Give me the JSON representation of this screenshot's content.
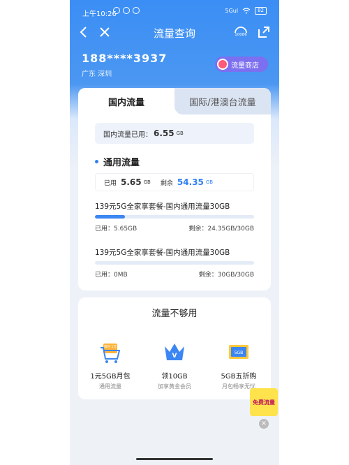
{
  "status_bar": {
    "time": "上午10:26",
    "signal": "5Gul",
    "battery": "82"
  },
  "nav": {
    "title": "流量查询",
    "service_label": "10086"
  },
  "account": {
    "phone": "188****3937",
    "location": "广东 深圳",
    "shop_button": "流量商店"
  },
  "tabs": {
    "domestic": "国内流量",
    "international": "国际/港澳台流量"
  },
  "domestic_used": {
    "label": "国内流量已用：",
    "value": "6.55",
    "unit": "GB"
  },
  "general": {
    "title": "通用流量",
    "used_label": "已用",
    "used_value": "5.65",
    "used_unit": "GB",
    "remain_label": "剩余",
    "remain_value": "54.35",
    "remain_unit": "GB"
  },
  "packages": [
    {
      "name": "139元5G全家享套餐-国内通用流量30GB",
      "used": "已用：5.65GB",
      "remain": "剩余：24.35GB/30GB",
      "progress_percent": 18.8
    },
    {
      "name": "139元5G全家享套餐-国内通用流量30GB",
      "used": "已用：0MB",
      "remain": "剩余：30GB/30GB",
      "progress_percent": 0
    }
  ],
  "not_enough": {
    "title": "流量不够用",
    "offers": [
      {
        "icon": "cart-icon",
        "badge": "限时 1元",
        "line1": "1元5GB月包",
        "line2": "通用流量"
      },
      {
        "icon": "crown-icon",
        "badge": "V",
        "line1": "领10GB",
        "line2": "加享黄金会员"
      },
      {
        "icon": "coupon-icon",
        "badge": "5GB",
        "line1": "5GB五折购",
        "line2": "月包畅享无忧"
      }
    ]
  },
  "float_ad": {
    "text": "免费流量"
  },
  "colors": {
    "accent": "#2e7ff2",
    "header": "#3b8ef5"
  }
}
